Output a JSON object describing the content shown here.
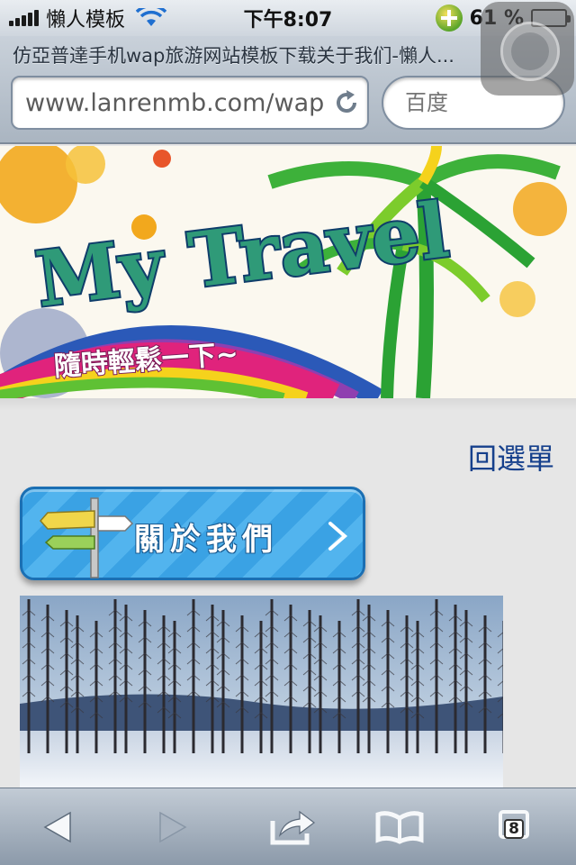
{
  "status_bar": {
    "carrier": "懶人模板",
    "time": "下午8:07",
    "battery_percent": "61 %",
    "battery_level": 0.61
  },
  "browser": {
    "page_title": "仿亞普達手机wap旅游网站模板下载关于我们-懶人...",
    "url": "www.lanrenmb.com/wap",
    "search_placeholder": "百度"
  },
  "banner": {
    "title": "My Travel",
    "subtitle": "隨時輕鬆一下~"
  },
  "content": {
    "back_link": "回選單",
    "about_button_label": "關於我們"
  },
  "toolbar": {
    "tabs_count": "8"
  },
  "colors": {
    "link": "#16408c",
    "button_blue": "#3aa2e4",
    "battery_green": "#4dc23a"
  }
}
